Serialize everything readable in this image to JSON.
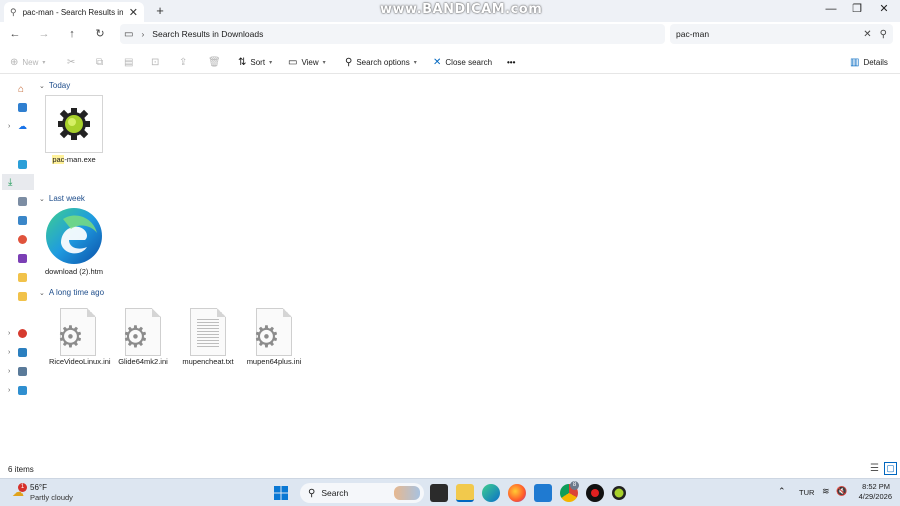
{
  "window": {
    "tab_title": "pac-man - Search Results in D",
    "watermark": "www.BANDICAM.com"
  },
  "address": {
    "breadcrumb": "Search Results in Downloads",
    "search_value": "pac-man"
  },
  "toolbar": {
    "new_label": "New",
    "sort_label": "Sort",
    "view_label": "View",
    "search_options_label": "Search options",
    "close_search_label": "Close search",
    "more_label": "•••",
    "details_label": "Details"
  },
  "groups": {
    "today": "Today",
    "last_week": "Last week",
    "long_ago": "A long time ago"
  },
  "files": [
    {
      "name_hl": "pac",
      "name_rest": "-man.exe"
    },
    {
      "name": "download (2).htm"
    },
    {
      "name": "RiceVideoLinux.ini"
    },
    {
      "name": "Glide64mk2.ini"
    },
    {
      "name": "mupencheat.txt"
    },
    {
      "name": "mupen64plus.ini"
    }
  ],
  "status": {
    "item_count": "6 items"
  },
  "taskbar": {
    "weather_temp": "56°F",
    "weather_desc": "Partly cloudy",
    "weather_badge": "1",
    "search_label": "Search",
    "language": "TUR",
    "time": "8:52 PM",
    "date": "4/29/2026",
    "chrome_badge": "8"
  },
  "colors": {
    "accent": "#0067c0",
    "highlight": "#fff19a",
    "taskbar": "#dde6f1"
  }
}
